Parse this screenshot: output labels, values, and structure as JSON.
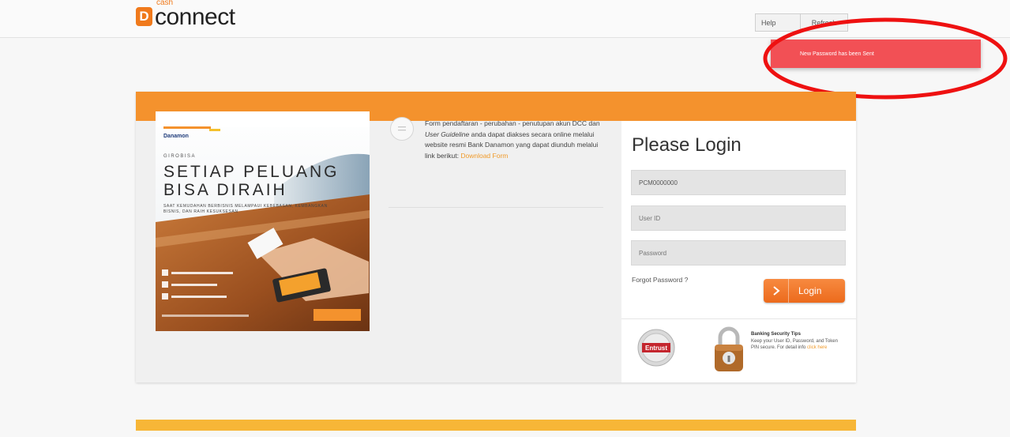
{
  "header": {
    "logo_badge": "D",
    "logo_cash": "cash",
    "logo_text": "connect",
    "help_label": "Help",
    "refresh_label": "Refresh"
  },
  "toast": {
    "message": "New Password has been Sent"
  },
  "promo": {
    "brand": "Danamon",
    "kicker": "GIROBISA",
    "headline_1": "SETIAP PELUANG",
    "headline_2": "BISA DIRAIH",
    "subhead": "SAAT KEMUDAHAN BERBISNIS MELAMPAUI KEBEBASAN, KEMBANGKAN BISNIS, DAN RAIH KESUKSESAN"
  },
  "info": {
    "text_1": "Form pendaftaran - perubahan - penutupan akun DCC dan ",
    "text_em": "User Guideline",
    "text_2": " anda dapat diakses secara online melalui website resmi Bank Danamon yang dapat diunduh melalui link berikut: ",
    "link_label": "Download Form"
  },
  "login": {
    "title": "Please Login",
    "company_value": "PCM0000000",
    "user_placeholder": "User ID",
    "password_placeholder": "Password",
    "forgot_label": "Forgot Password ?",
    "button_label": "Login"
  },
  "security": {
    "entrust_label": "Entrust",
    "title": "Banking Security Tips",
    "text": "Keep your User ID, Password, and Token PIN secure. For detail info ",
    "link_label": "click here"
  },
  "colors": {
    "brand_orange": "#f4922d",
    "toast_red": "#f25055",
    "footer_yellow": "#f7b637"
  }
}
